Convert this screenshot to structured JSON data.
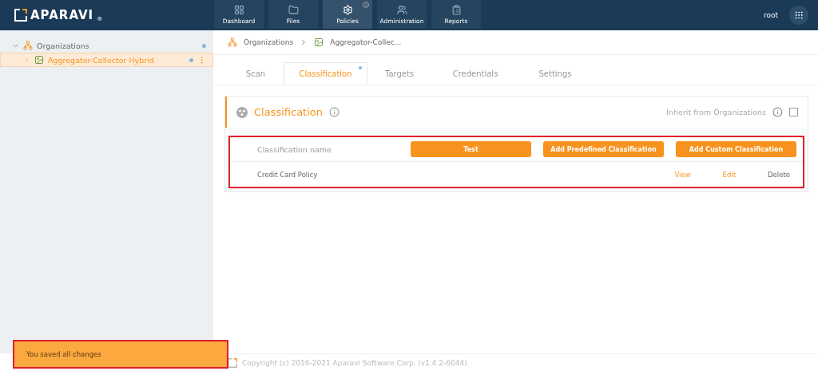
{
  "header": {
    "logo": "APARAVI",
    "logo_mark": "®",
    "nav": [
      {
        "label": "Dashboard",
        "selected": false,
        "info": false
      },
      {
        "label": "Files",
        "selected": false,
        "info": false
      },
      {
        "label": "Policies",
        "selected": true,
        "info": true
      },
      {
        "label": "Administration",
        "selected": false,
        "info": false
      },
      {
        "label": "Reports",
        "selected": false,
        "info": false
      }
    ],
    "user": "root"
  },
  "sidebar": {
    "items": [
      {
        "label": "Organizations",
        "expanded": true,
        "selected": false,
        "children": [
          {
            "label": "Aggregator-Collector Hybrid",
            "expanded": false,
            "selected": true
          }
        ]
      }
    ]
  },
  "breadcrumb": [
    {
      "label": "Organizations"
    },
    {
      "label": "Aggregator-Collec..."
    }
  ],
  "tabs": [
    {
      "label": "Scan",
      "selected": false
    },
    {
      "label": "Classification",
      "selected": true,
      "modified": true
    },
    {
      "label": "Targets",
      "selected": false
    },
    {
      "label": "Credentials",
      "selected": false
    },
    {
      "label": "Settings",
      "selected": false
    }
  ],
  "panel": {
    "title": "Classification",
    "inherit_label": "Inherit from Organizations",
    "inherit_checked": false,
    "column_header": "Classification name",
    "buttons": [
      "Test",
      "Add Predefined Classification",
      "Add Custom Classification"
    ],
    "rows": [
      {
        "name": "Credit Card Policy",
        "actions": [
          {
            "label": "View",
            "kind": "accent"
          },
          {
            "label": "Edit",
            "kind": "accent"
          },
          {
            "label": "Delete",
            "kind": "plain"
          }
        ]
      }
    ]
  },
  "toast": "You saved all changes",
  "footer": "Copyright (c) 2016-2021 Aparavi Software Corp. (v1.4.2-6044)"
}
